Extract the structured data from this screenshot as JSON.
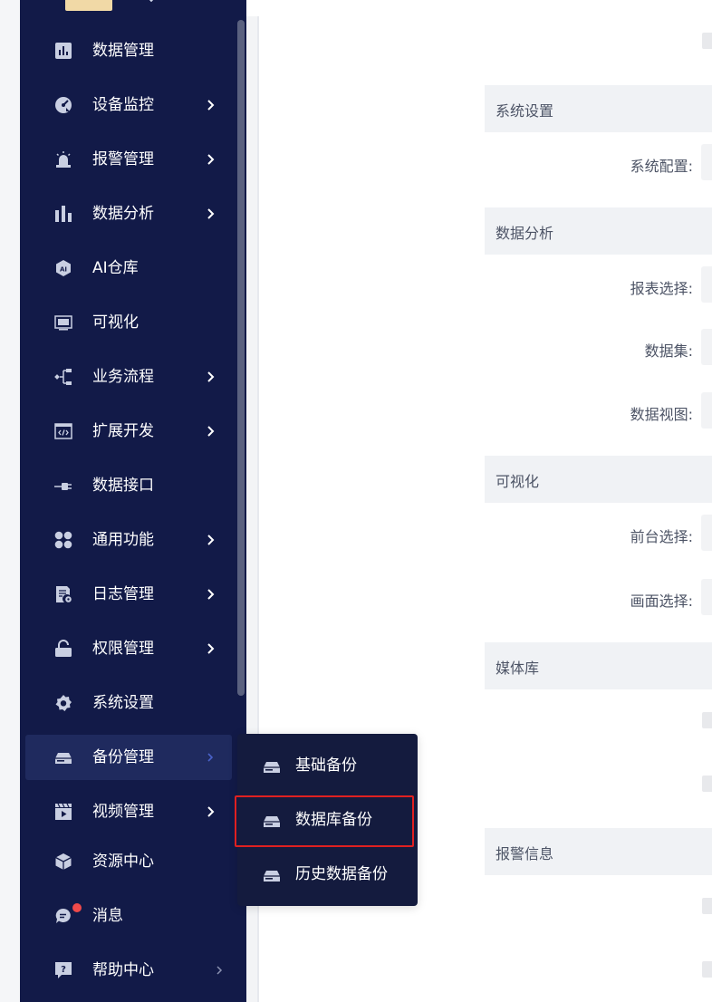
{
  "sidebar": {
    "items": [
      {
        "label": "数据管理",
        "icon": "bar-chart-square-icon",
        "has_submenu": false
      },
      {
        "label": "设备监控",
        "icon": "speed-gauge-icon",
        "has_submenu": true
      },
      {
        "label": "报警管理",
        "icon": "alarm-light-icon",
        "has_submenu": true
      },
      {
        "label": "数据分析",
        "icon": "bar-chart-icon",
        "has_submenu": true
      },
      {
        "label": "AI仓库",
        "icon": "ai-hexagon-icon",
        "has_submenu": false
      },
      {
        "label": "可视化",
        "icon": "monitor-icon",
        "has_submenu": false
      },
      {
        "label": "业务流程",
        "icon": "flow-chart-icon",
        "has_submenu": true
      },
      {
        "label": "扩展开发",
        "icon": "code-window-icon",
        "has_submenu": true
      },
      {
        "label": "数据接口",
        "icon": "plug-icon",
        "has_submenu": false
      },
      {
        "label": "通用功能",
        "icon": "four-petal-icon",
        "has_submenu": true
      },
      {
        "label": "日志管理",
        "icon": "log-file-icon",
        "has_submenu": true
      },
      {
        "label": "权限管理",
        "icon": "unlock-icon",
        "has_submenu": true
      },
      {
        "label": "系统设置",
        "icon": "gear-icon",
        "has_submenu": false
      },
      {
        "label": "备份管理",
        "icon": "hard-drive-icon",
        "has_submenu": true,
        "active": true
      },
      {
        "label": "视频管理",
        "icon": "video-clapper-icon",
        "has_submenu": true
      },
      {
        "label": "资源中心",
        "icon": "cube-icon",
        "has_submenu": false
      },
      {
        "label": "消息",
        "icon": "chat-bubble-icon",
        "has_submenu": false,
        "badge": true
      },
      {
        "label": "帮助中心",
        "icon": "help-square-icon",
        "has_submenu": true
      }
    ]
  },
  "submenu": {
    "items": [
      {
        "label": "基础备份"
      },
      {
        "label": "数据库备份",
        "highlighted": true
      },
      {
        "label": "历史数据备份"
      }
    ]
  },
  "content": {
    "sections": [
      {
        "title": "系统设置",
        "fields": [
          {
            "label": "系统配置:"
          }
        ]
      },
      {
        "title": "数据分析",
        "fields": [
          {
            "label": "报表选择:"
          },
          {
            "label": "数据集:"
          },
          {
            "label": "数据视图:"
          }
        ]
      },
      {
        "title": "可视化",
        "fields": [
          {
            "label": "前台选择:"
          },
          {
            "label": "画面选择:"
          }
        ]
      },
      {
        "title": "媒体库",
        "fields": []
      },
      {
        "title": "报警信息",
        "fields": []
      }
    ]
  },
  "colors": {
    "sidebar_bg": "#121a48",
    "active_item_bg": "#1f2a5e",
    "submenu_bg": "#141b3e",
    "highlight_border": "#e02020",
    "badge": "#f04a4a",
    "section_header_bg": "#f0f2f5"
  }
}
